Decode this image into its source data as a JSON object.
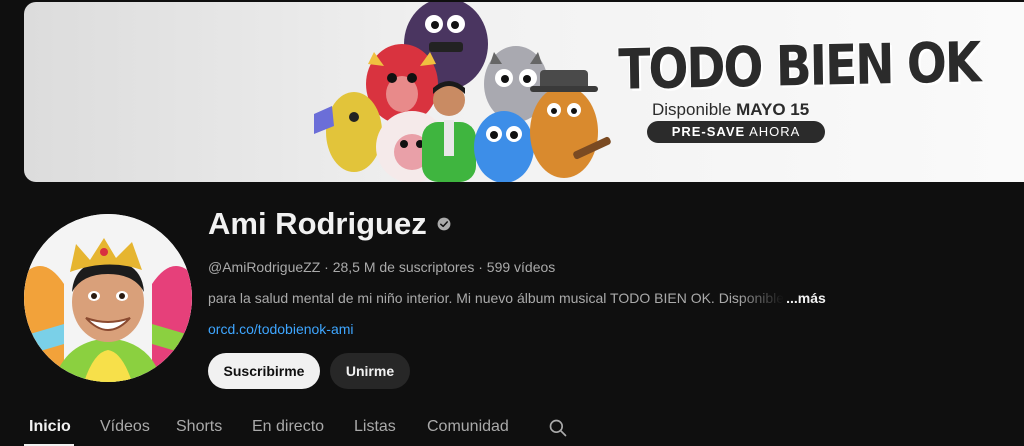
{
  "banner": {
    "title": "TODO BIEN OK",
    "available_prefix": "Disponible",
    "available_date": "MAYO 15",
    "presave_bold": "PRE-SAVE",
    "presave_rest": " AHORA"
  },
  "channel": {
    "name": "Ami Rodriguez",
    "handle": "@AmiRodrigueZZ",
    "subscribers": "28,5 M de suscriptores",
    "videos": "599 vídeos",
    "separator": " · ",
    "description": "para la salud mental de mi niño interior. Mi nuevo álbum musical TODO BIEN OK. Disponible",
    "more_label": "...más",
    "link": "orcd.co/todobienok-ami"
  },
  "buttons": {
    "subscribe": "Suscribirme",
    "join": "Unirme"
  },
  "tabs": [
    {
      "label": "Inicio",
      "active": true
    },
    {
      "label": "Vídeos",
      "active": false
    },
    {
      "label": "Shorts",
      "active": false
    },
    {
      "label": "En directo",
      "active": false
    },
    {
      "label": "Listas",
      "active": false
    },
    {
      "label": "Comunidad",
      "active": false
    }
  ],
  "icons": {
    "verified": "verified-check-icon",
    "search": "search-icon"
  },
  "colors": {
    "background": "#0f0f0f",
    "link": "#3ea6ff",
    "subscribe_bg": "#f1f1f1",
    "join_bg": "#272727"
  }
}
